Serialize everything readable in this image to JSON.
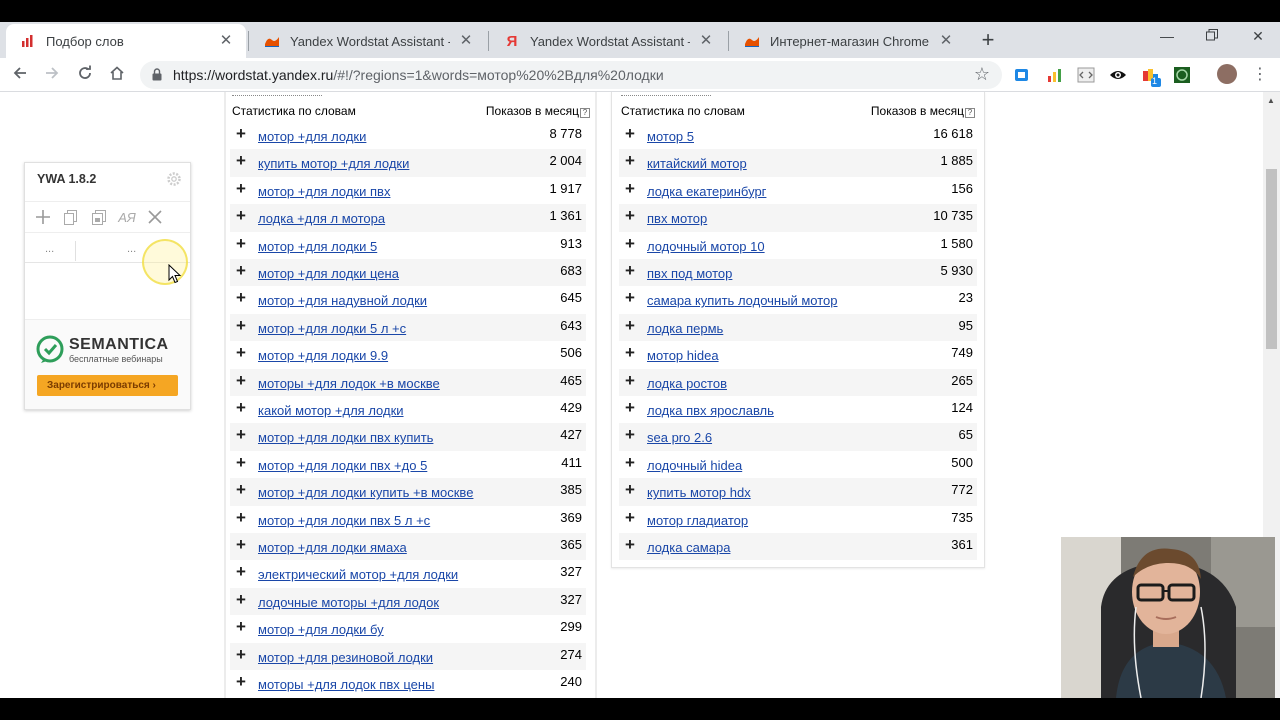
{
  "browser": {
    "tabs": [
      {
        "title": "Подбор слов",
        "icon": "wordstat-bars-icon",
        "active": true
      },
      {
        "title": "Yandex Wordstat Assistant - Инт",
        "icon": "ywa-extension-icon",
        "active": false
      },
      {
        "title": "Yandex Wordstat Assistant — Янд",
        "icon": "yandex-y-icon",
        "active": false
      },
      {
        "title": "Интернет-магазин Chrome - yan",
        "icon": "chrome-webstore-icon",
        "active": false
      }
    ],
    "url_host": "https://wordstat.yandex.ru",
    "url_rest": "/#!/?regions=1&words=мотор%20%2Bдля%20лодки",
    "extensions": [
      "ywa-badge-icon",
      "chart-icon",
      "code-icon",
      "eye-icon",
      "flag-icon",
      "green-ext-icon",
      "avatar",
      "more-icon"
    ],
    "ext_badge": "1"
  },
  "ywa": {
    "version": "YWA 1.8.2",
    "col1": "...",
    "col2": "...",
    "ad_brand": "SEMANTICA",
    "ad_sub": "бесплатные вебинары",
    "ad_button": "Зарегистрироваться ›"
  },
  "left_table": {
    "header_left": "Статистика по словам",
    "header_right": "Показов в месяц",
    "rows": [
      {
        "kw": "мотор +для лодки",
        "n": "8 778"
      },
      {
        "kw": "купить мотор +для лодки",
        "n": "2 004"
      },
      {
        "kw": "мотор +для лодки пвх",
        "n": "1 917"
      },
      {
        "kw": "лодка +для л мотора",
        "n": "1 361"
      },
      {
        "kw": "мотор +для лодки 5",
        "n": "913"
      },
      {
        "kw": "мотор +для лодки цена",
        "n": "683"
      },
      {
        "kw": "мотор +для надувной лодки",
        "n": "645"
      },
      {
        "kw": "мотор +для лодки 5 л +с",
        "n": "643"
      },
      {
        "kw": "мотор +для лодки 9.9",
        "n": "506"
      },
      {
        "kw": "моторы +для лодок +в москве",
        "n": "465"
      },
      {
        "kw": "какой мотор +для лодки",
        "n": "429"
      },
      {
        "kw": "мотор +для лодки пвх купить",
        "n": "427"
      },
      {
        "kw": "мотор +для лодки пвх +до 5",
        "n": "411"
      },
      {
        "kw": "мотор +для лодки купить +в москве",
        "n": "385"
      },
      {
        "kw": "мотор +для лодки пвх 5 л +с",
        "n": "369"
      },
      {
        "kw": "мотор +для лодки ямаха",
        "n": "365"
      },
      {
        "kw": "электрический мотор +для лодки",
        "n": "327"
      },
      {
        "kw": "лодочные моторы +для лодок",
        "n": "327"
      },
      {
        "kw": "мотор +для лодки бу",
        "n": "299"
      },
      {
        "kw": "мотор +для резиновой лодки",
        "n": "274"
      },
      {
        "kw": "моторы +для лодок пвх цены",
        "n": "240"
      }
    ]
  },
  "right_table": {
    "header_left": "Статистика по словам",
    "header_right": "Показов в месяц",
    "rows": [
      {
        "kw": "мотор 5",
        "n": "16 618"
      },
      {
        "kw": "китайский мотор",
        "n": "1 885"
      },
      {
        "kw": "лодка екатеринбург",
        "n": "156"
      },
      {
        "kw": "пвх мотор",
        "n": "10 735"
      },
      {
        "kw": "лодочный мотор 10",
        "n": "1 580"
      },
      {
        "kw": "пвх под мотор",
        "n": "5 930"
      },
      {
        "kw": "самара купить лодочный мотор",
        "n": "23"
      },
      {
        "kw": "лодка пермь",
        "n": "95"
      },
      {
        "kw": "мотор hidea",
        "n": "749"
      },
      {
        "kw": "лодка ростов",
        "n": "265"
      },
      {
        "kw": "лодка пвх ярославль",
        "n": "124"
      },
      {
        "kw": "sea pro 2.6",
        "n": "65"
      },
      {
        "kw": "лодочный hidea",
        "n": "500"
      },
      {
        "kw": "купить мотор hdx",
        "n": "772"
      },
      {
        "kw": "мотор гладиатор",
        "n": "735"
      },
      {
        "kw": "лодка самара",
        "n": "361"
      }
    ]
  },
  "colors": {
    "link": "#1a47a8",
    "row_alt": "#f5f5f5",
    "ad_button": "#f5a623",
    "semantica_green": "#2e9e5a"
  }
}
